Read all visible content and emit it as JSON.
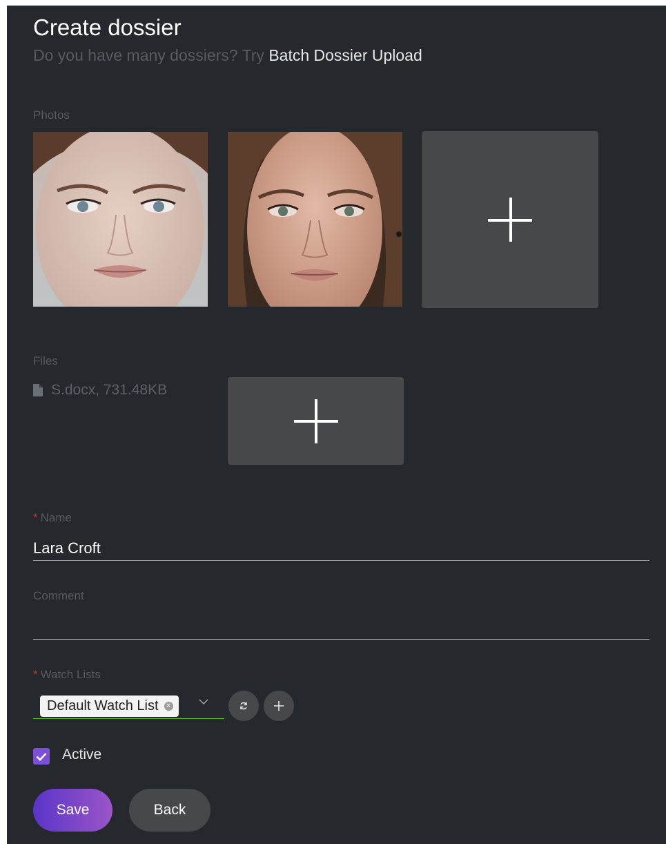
{
  "header": {
    "title": "Create dossier",
    "subtitle_prefix": "Do you have many dossiers? Try ",
    "subtitle_link": "Batch Dossier Upload"
  },
  "photos": {
    "label": "Photos",
    "items": [
      {
        "name": "face-photo-1"
      },
      {
        "name": "face-photo-2"
      }
    ]
  },
  "files": {
    "label": "Files",
    "items": [
      {
        "text": "S.docx, 731.48KB"
      }
    ]
  },
  "name_field": {
    "required_mark": "*",
    "label": "Name",
    "value": "Lara Croft"
  },
  "comment_field": {
    "label": "Comment",
    "value": ""
  },
  "watch_lists": {
    "required_mark": "*",
    "label": "Watch Lists",
    "selected": [
      "Default Watch List"
    ]
  },
  "active": {
    "label": "Active",
    "checked": true
  },
  "actions": {
    "save_label": "Save",
    "back_label": "Back"
  },
  "colors": {
    "background": "#25282d",
    "tile": "#46484c",
    "accent_valid": "#6bc62a",
    "checkbox": "#7c4fd9",
    "required": "#c0392b",
    "save_gradient_start": "#5a35c9",
    "save_gradient_end": "#9b55c8"
  },
  "icons": {
    "add_photo": "plus-icon",
    "add_file": "plus-icon",
    "file": "file-icon",
    "refresh": "refresh-icon",
    "add_watch_list": "plus-icon",
    "chip_remove": "close-circle-icon",
    "dropdown": "chevron-down-icon",
    "checkbox": "checkmark-icon"
  }
}
